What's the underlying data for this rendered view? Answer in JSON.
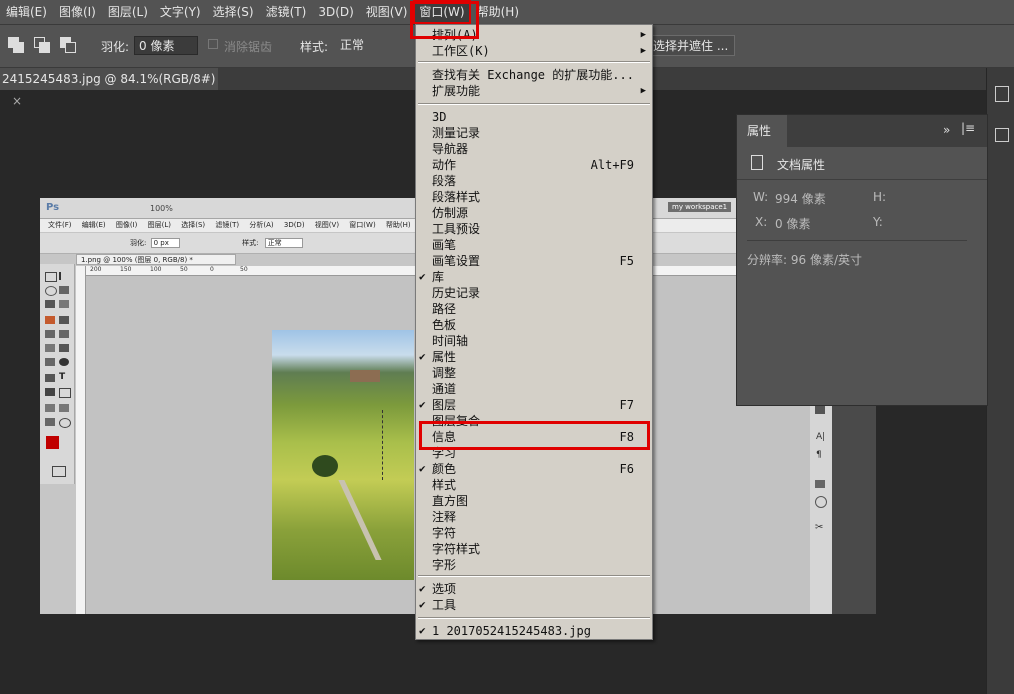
{
  "menubar": {
    "items": [
      "编辑(E)",
      "图像(I)",
      "图层(L)",
      "文字(Y)",
      "选择(S)",
      "滤镜(T)",
      "3D(D)",
      "视图(V)",
      "窗口(W)",
      "帮助(H)"
    ],
    "active": "窗口(W)"
  },
  "optionsbar": {
    "feather_label": "羽化:",
    "feather_value": "0 像素",
    "antialias_label": "消除锯齿",
    "style_label": "样式:",
    "style_value": "正常",
    "refine_button": "选择并遮住 ..."
  },
  "document_tab": {
    "title": "2415245483.jpg @ 84.1%(RGB/8#)",
    "close": "×"
  },
  "properties_panel": {
    "tab": "属性",
    "header": "文档属性",
    "w_label": "W:",
    "w_value": "994 像素",
    "h_label": "H:",
    "x_label": "X:",
    "x_value": "0 像素",
    "y_label": "Y:",
    "resolution": "分辨率: 96 像素/英寸"
  },
  "window_menu": {
    "items": [
      {
        "label": "排列(A)",
        "submenu": true
      },
      {
        "label": "工作区(K)",
        "submenu": true
      },
      {
        "label": "查找有关 Exchange 的扩展功能..."
      },
      {
        "label": "扩展功能",
        "submenu": true
      },
      {
        "label": "3D"
      },
      {
        "label": "测量记录"
      },
      {
        "label": "导航器"
      },
      {
        "label": "动作",
        "shortcut": "Alt+F9"
      },
      {
        "label": "段落"
      },
      {
        "label": "段落样式"
      },
      {
        "label": "仿制源"
      },
      {
        "label": "工具预设"
      },
      {
        "label": "画笔"
      },
      {
        "label": "画笔设置",
        "shortcut": "F5"
      },
      {
        "label": "库",
        "checked": true
      },
      {
        "label": "历史记录"
      },
      {
        "label": "路径"
      },
      {
        "label": "色板"
      },
      {
        "label": "时间轴"
      },
      {
        "label": "属性",
        "checked": true
      },
      {
        "label": "调整"
      },
      {
        "label": "通道"
      },
      {
        "label": "图层",
        "shortcut": "F7",
        "checked": true
      },
      {
        "label": "图层复合"
      },
      {
        "label": "信息",
        "shortcut": "F8",
        "highlighted": true
      },
      {
        "label": "学习"
      },
      {
        "label": "颜色",
        "shortcut": "F6",
        "checked": true
      },
      {
        "label": "样式"
      },
      {
        "label": "直方图"
      },
      {
        "label": "注释"
      },
      {
        "label": "字符"
      },
      {
        "label": "字符样式"
      },
      {
        "label": "字形"
      },
      {
        "label": "选项",
        "checked": true
      },
      {
        "label": "工具",
        "checked": true
      },
      {
        "label": "1 2017052415245483.jpg",
        "checked": true
      }
    ]
  },
  "embedded_screenshot": {
    "menu": [
      "文件(F)",
      "编辑(E)",
      "图像(I)",
      "图层(L)",
      "选择(S)",
      "滤镜(T)",
      "分析(A)",
      "3D(D)",
      "视图(V)",
      "窗口(W)",
      "帮助(H)"
    ],
    "zoom": "100%",
    "workspace": "my workspace1",
    "tab": "1.png @ 100% (图层 0, RGB/8) *",
    "feather_label": "羽化:",
    "feather_value": "0 px",
    "style_label": "样式:",
    "style_value": "正常",
    "ruler_ticks": [
      "200",
      "150",
      "100",
      "50",
      "0",
      "50"
    ]
  }
}
